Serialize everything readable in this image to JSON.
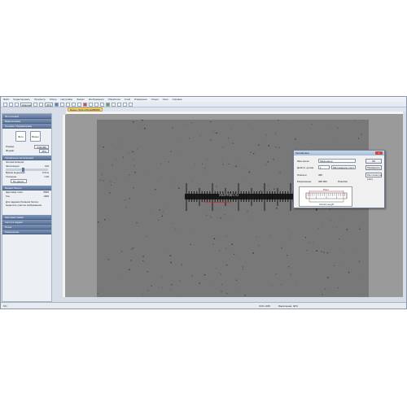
{
  "watermark": "sturman.ru",
  "menu": [
    "Файл",
    "Редактировать",
    "Просмотр",
    "Обзор",
    "Настройки",
    "Захват",
    "Изображения",
    "Обработка",
    "Слой",
    "Измерения",
    "Опции",
    "Окно",
    "Справка"
  ],
  "toolbar": {
    "zoom_label": "Ширина",
    "zoom_value": "40%"
  },
  "document_tab": "Видео (SOLCOM-EMB806)",
  "left_panel": {
    "sections": [
      {
        "title": "Фотосъемка"
      },
      {
        "title": "Видеосъемка"
      },
      {
        "title": "Съемка с Параметрами"
      }
    ],
    "big_buttons": [
      "Фото",
      "Видео"
    ],
    "rows": [
      {
        "label": "Размер",
        "value": "640x480"
      },
      {
        "label": "Формат",
        "value": "JPG"
      }
    ],
    "exposure_header": "Управление экспозицией",
    "exposure_rows": [
      {
        "label": "Автоэкспозиция",
        "value": ""
      },
      {
        "label": "Экспозиция",
        "value": "100"
      },
      {
        "label": "Время выдержки",
        "value": "0.3ms"
      },
      {
        "label": "Усиление",
        "value": "1.00"
      }
    ],
    "default_btn": "По умолч.",
    "color_header": "Баланс белого",
    "color_rows": [
      {
        "label": "Цветовая темп.",
        "value": "6500"
      },
      {
        "label": "Тон",
        "value": "1000"
      }
    ],
    "help_text": "Для задания баланса белого выделите участок изображения",
    "bottom_sections": [
      "Цветовая гамма",
      "Частота кадров",
      "Поток",
      "Разрешение"
    ]
  },
  "dialog": {
    "title": "Калибровка",
    "close": "x",
    "name_label": "Имя метки",
    "name_value": "Микрометр",
    "ok": "ОК",
    "actual_label": "Действ. длина",
    "actual_value": "1",
    "unit_value": "Миллиметры (mm)",
    "apply": "Применить",
    "pixels_label": "Пиксели",
    "pixels_value": "380",
    "resolution_label": "Разрешение",
    "resolution_value": "380.000",
    "res_unit": "Пикс/мм",
    "diagram_top": "Pixel",
    "diagram_bottom": "Actual Length"
  },
  "status": {
    "left": "ОС",
    "resolution": "640 x 480",
    "zoom": "Увеличение: 40%"
  }
}
